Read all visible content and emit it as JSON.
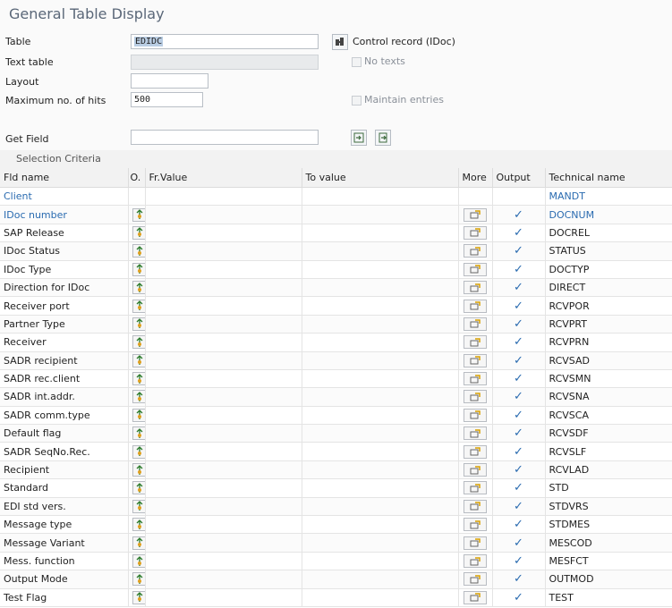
{
  "title": "General Table Display",
  "form": {
    "table_label": "Table",
    "table_value": "EDIDC",
    "text_table_label": "Text table",
    "text_table_value": "",
    "layout_label": "Layout",
    "layout_value": "",
    "max_hits_label": "Maximum no. of hits",
    "max_hits_value": "500",
    "get_field_label": "Get Field",
    "get_field_value": "",
    "control_record_text": "Control record (IDoc)",
    "no_texts_label": "No texts",
    "maintain_entries_label": "Maintain entries"
  },
  "selection": {
    "section_title": "Selection Criteria",
    "headers": {
      "fld_name": "Fld name",
      "option": "O.",
      "fr_value": "Fr.Value",
      "to_value": "To value",
      "more": "More",
      "output": "Output",
      "technical_name": "Technical name"
    },
    "rows": [
      {
        "fld": "Client",
        "tech": "MANDT",
        "key": true,
        "editable": false,
        "output": false
      },
      {
        "fld": "IDoc number",
        "tech": "DOCNUM",
        "key": true,
        "editable": true,
        "output": true
      },
      {
        "fld": "SAP Release",
        "tech": "DOCREL",
        "key": false,
        "editable": true,
        "output": true
      },
      {
        "fld": "IDoc Status",
        "tech": "STATUS",
        "key": false,
        "editable": true,
        "output": true
      },
      {
        "fld": "IDoc Type",
        "tech": "DOCTYP",
        "key": false,
        "editable": true,
        "output": true
      },
      {
        "fld": "Direction for IDoc",
        "tech": "DIRECT",
        "key": false,
        "editable": true,
        "output": true
      },
      {
        "fld": "Receiver port",
        "tech": "RCVPOR",
        "key": false,
        "editable": true,
        "output": true
      },
      {
        "fld": "Partner Type",
        "tech": "RCVPRT",
        "key": false,
        "editable": true,
        "output": true
      },
      {
        "fld": "Receiver",
        "tech": "RCVPRN",
        "key": false,
        "editable": true,
        "output": true
      },
      {
        "fld": "SADR recipient",
        "tech": "RCVSAD",
        "key": false,
        "editable": true,
        "output": true
      },
      {
        "fld": "SADR rec.client",
        "tech": "RCVSMN",
        "key": false,
        "editable": true,
        "output": true
      },
      {
        "fld": "SADR int.addr.",
        "tech": "RCVSNA",
        "key": false,
        "editable": true,
        "output": true
      },
      {
        "fld": "SADR comm.type",
        "tech": "RCVSCA",
        "key": false,
        "editable": true,
        "output": true
      },
      {
        "fld": "Default flag",
        "tech": "RCVSDF",
        "key": false,
        "editable": true,
        "output": true
      },
      {
        "fld": "SADR SeqNo.Rec.",
        "tech": "RCVSLF",
        "key": false,
        "editable": true,
        "output": true
      },
      {
        "fld": "Recipient",
        "tech": "RCVLAD",
        "key": false,
        "editable": true,
        "output": true
      },
      {
        "fld": "Standard",
        "tech": "STD",
        "key": false,
        "editable": true,
        "output": true
      },
      {
        "fld": "EDI std vers.",
        "tech": "STDVRS",
        "key": false,
        "editable": true,
        "output": true
      },
      {
        "fld": "Message type",
        "tech": "STDMES",
        "key": false,
        "editable": true,
        "output": true
      },
      {
        "fld": "Message Variant",
        "tech": "MESCOD",
        "key": false,
        "editable": true,
        "output": true
      },
      {
        "fld": "Mess. function",
        "tech": "MESFCT",
        "key": false,
        "editable": true,
        "output": true
      },
      {
        "fld": "Output Mode",
        "tech": "OUTMOD",
        "key": false,
        "editable": true,
        "output": true
      },
      {
        "fld": "Test Flag",
        "tech": "TEST",
        "key": false,
        "editable": true,
        "output": true
      }
    ]
  },
  "icons": {
    "control_record": "control-record-icon",
    "option": "selection-option-icon",
    "more": "multiple-selection-icon",
    "output_check": "checkmark-icon"
  },
  "colors": {
    "key_field": "#2a6bb0",
    "check": "#2a6bb0",
    "header_bg": "#f2f2f2"
  }
}
